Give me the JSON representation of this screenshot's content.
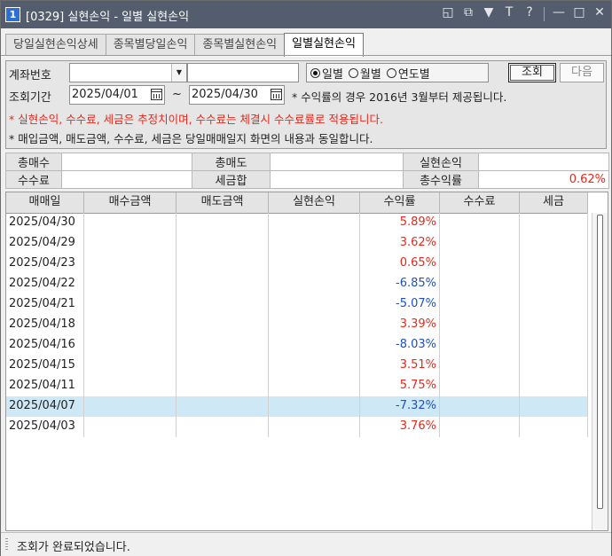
{
  "window": {
    "number": "1",
    "title": "[0329] 실현손익 - 일별 실현손익",
    "icons": [
      "restore-icon",
      "copy-window-icon",
      "pin-icon",
      "font-icon",
      "help-icon",
      "minimize-icon",
      "maximize-icon",
      "close-icon"
    ]
  },
  "title_icons": {
    "restore": "◱",
    "copy": "⧉",
    "pin": "▼",
    "font": "T",
    "help": "?",
    "minimize": "—",
    "maximize": "□",
    "close": "✕"
  },
  "tabs": [
    "당일실현손익상세",
    "종목별당일손익",
    "종목별실현손익",
    "일별실현손익"
  ],
  "active_tab": "일별실현손익",
  "form": {
    "account_label": "계좌번호",
    "account_value": "",
    "account_name": "",
    "period_label": "조회기간",
    "radio": [
      {
        "label": "일별",
        "checked": true
      },
      {
        "label": "월별",
        "checked": false
      },
      {
        "label": "연도별",
        "checked": false
      }
    ],
    "search_button": "조회",
    "next_button": "다음",
    "start_date": "2025/04/01",
    "tilde": "~",
    "end_date": "2025/04/30",
    "note_period": "* 수익률의 경우 2016년 3월부터 제공됩니다.",
    "note_red": "* 실현손익, 수수료, 세금은 추정치이며, 수수료는 체결시 수수료률로 적용됩니다.",
    "note_black": "* 매입금액, 매도금액, 수수료, 세금은 당일매매일지 화면의 내용과 동일합니다."
  },
  "summary": {
    "total_buy_label": "총매수",
    "total_buy_value": "",
    "total_sell_label": "총매도",
    "total_sell_value": "",
    "realized_pl_label": "실현손익",
    "realized_pl_value": "",
    "fee_label": "수수료",
    "fee_value": "",
    "tax_total_label": "세금합",
    "tax_total_value": "",
    "total_return_label": "총수익률",
    "total_return_value": "0.62%"
  },
  "grid": {
    "columns": [
      "매매일",
      "매수금액",
      "매도금액",
      "실현손익",
      "수익률",
      "수수료",
      "세금"
    ],
    "rows": [
      {
        "date": "2025/04/30",
        "rate": "5.89%",
        "dir": "pos"
      },
      {
        "date": "2025/04/29",
        "rate": "3.62%",
        "dir": "pos"
      },
      {
        "date": "2025/04/23",
        "rate": "0.65%",
        "dir": "pos"
      },
      {
        "date": "2025/04/22",
        "rate": "-6.85%",
        "dir": "neg"
      },
      {
        "date": "2025/04/21",
        "rate": "-5.07%",
        "dir": "neg"
      },
      {
        "date": "2025/04/18",
        "rate": "3.39%",
        "dir": "pos"
      },
      {
        "date": "2025/04/16",
        "rate": "-8.03%",
        "dir": "neg"
      },
      {
        "date": "2025/04/15",
        "rate": "3.51%",
        "dir": "pos"
      },
      {
        "date": "2025/04/11",
        "rate": "5.75%",
        "dir": "pos"
      },
      {
        "date": "2025/04/07",
        "rate": "-7.32%",
        "dir": "neg",
        "selected": true
      },
      {
        "date": "2025/04/03",
        "rate": "3.76%",
        "dir": "pos"
      }
    ]
  },
  "status": "조회가 완료되었습니다.",
  "colors": {
    "positive": "#e8281c",
    "negative": "#1c50c8",
    "selected_row": "#cfe8f6",
    "titlebar": "#535d6d"
  }
}
